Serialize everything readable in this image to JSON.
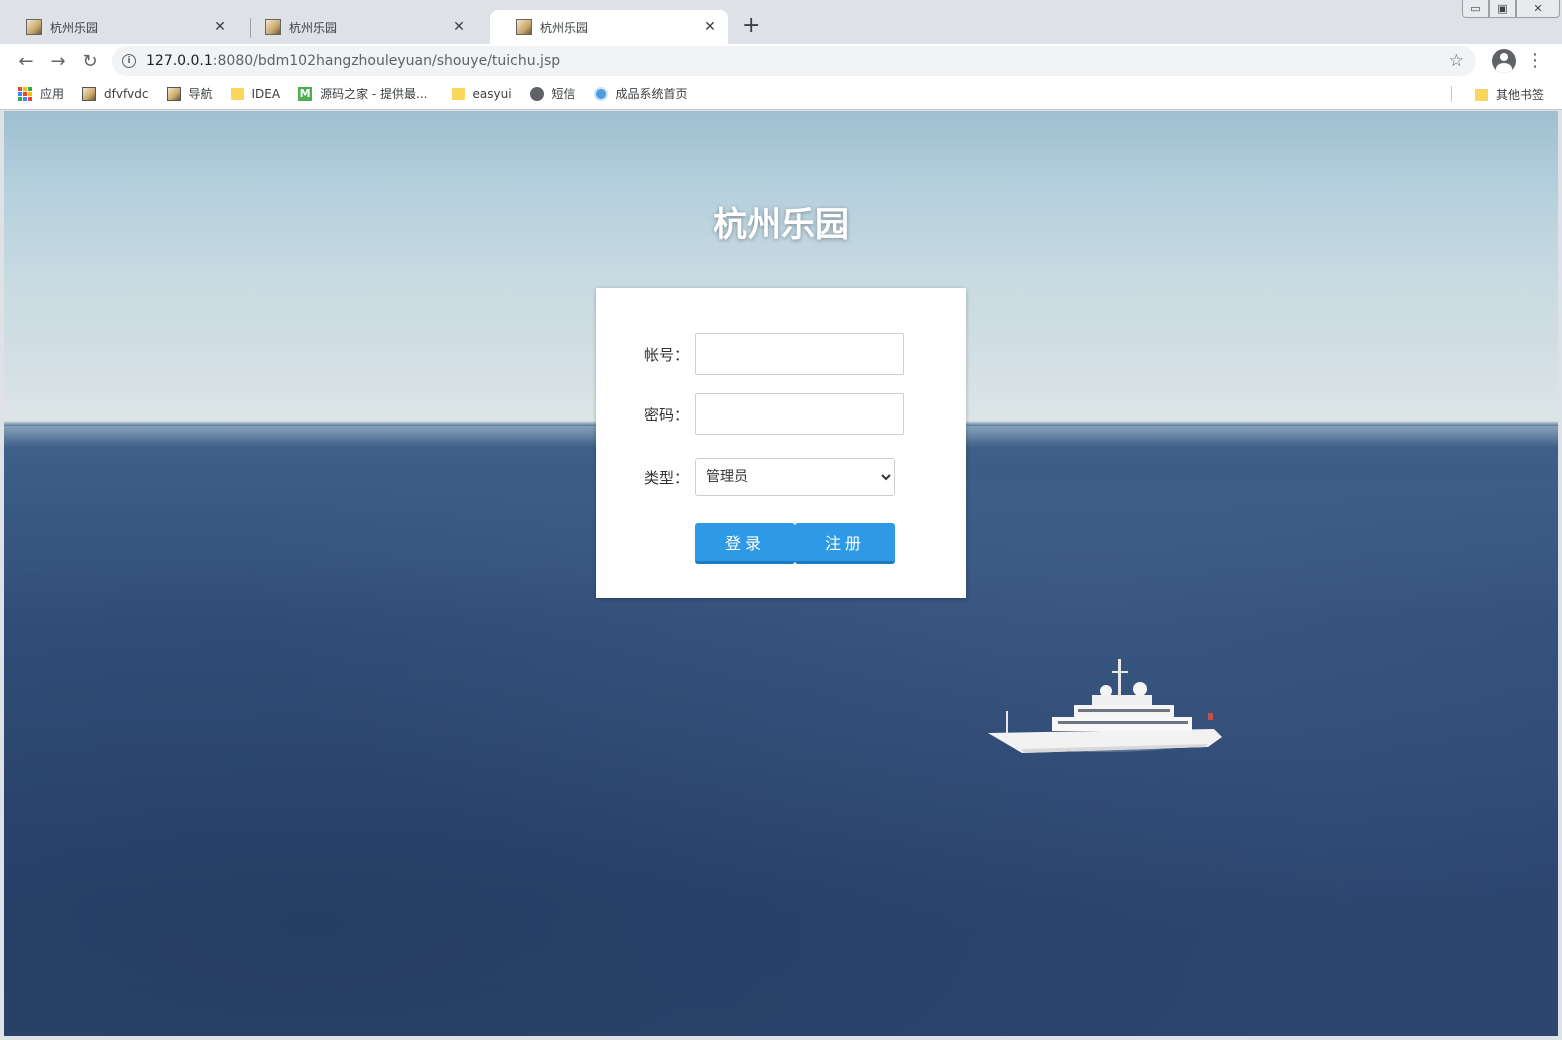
{
  "window_controls": {
    "minimize": "▭",
    "restore": "▣",
    "close": "✕"
  },
  "tabs": [
    {
      "title": "杭州乐园",
      "active": false
    },
    {
      "title": "杭州乐园",
      "active": false
    },
    {
      "title": "杭州乐园",
      "active": true
    }
  ],
  "tab_close_glyph": "✕",
  "new_tab_glyph": "+",
  "toolbar": {
    "back_icon": "←",
    "forward_icon": "→",
    "reload_icon": "↻",
    "url_host": "127.0.0.1",
    "url_path": ":8080/bdm102hangzhouleyuan/shouye/tuichu.jsp",
    "star_icon": "☆",
    "menu_icon": "⋮"
  },
  "bookmarks": {
    "items": [
      {
        "label": "应用",
        "icon": "apps-icon"
      },
      {
        "label": "dfvfvdc",
        "icon": "image-icon"
      },
      {
        "label": "导航",
        "icon": "image-icon"
      },
      {
        "label": "IDEA",
        "icon": "folder-icon"
      },
      {
        "label": "源码之家 - 提供最...",
        "icon": "m-icon",
        "icon_text": "M"
      },
      {
        "label": "easyui",
        "icon": "folder-icon"
      },
      {
        "label": "短信",
        "icon": "globe-icon"
      },
      {
        "label": "成品系统首页",
        "icon": "circle-icon"
      }
    ],
    "other": "其他书签"
  },
  "page": {
    "title": "杭州乐园",
    "form": {
      "account_label": "帐号：",
      "account_value": "",
      "password_label": "密码：",
      "password_value": "",
      "type_label": "类型：",
      "type_selected": "管理员",
      "login_button": "登录",
      "register_button": "注册"
    }
  },
  "colors": {
    "button": "#2e9ae6",
    "sea": "#324f7a",
    "sky": "#c8dae2"
  }
}
